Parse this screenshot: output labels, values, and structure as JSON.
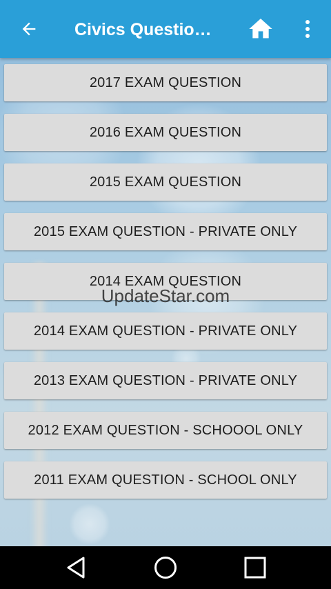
{
  "app_bar": {
    "title": "Civics Questio…",
    "back_icon": "arrow-left-icon",
    "home_icon": "home-icon",
    "menu_icon": "more-vert-icon",
    "background_color": "#2a9fd8"
  },
  "exam_buttons": [
    {
      "label": "2017 EXAM QUESTION"
    },
    {
      "label": "2016 EXAM QUESTION"
    },
    {
      "label": "2015 EXAM QUESTION"
    },
    {
      "label": "2015 EXAM QUESTION - PRIVATE ONLY"
    },
    {
      "label": "2014 EXAM QUESTION"
    },
    {
      "label": "2014 EXAM QUESTION - PRIVATE ONLY"
    },
    {
      "label": "2013 EXAM QUESTION - PRIVATE ONLY"
    },
    {
      "label": "2012 EXAM QUESTION - SCHOOOL ONLY"
    },
    {
      "label": "2011 EXAM QUESTION - SCHOOL ONLY"
    }
  ],
  "watermark": {
    "text": "UpdateStar.com"
  },
  "nav_bar": {
    "back_icon": "triangle-back-icon",
    "home_icon": "circle-home-icon",
    "recents_icon": "square-recents-icon"
  }
}
